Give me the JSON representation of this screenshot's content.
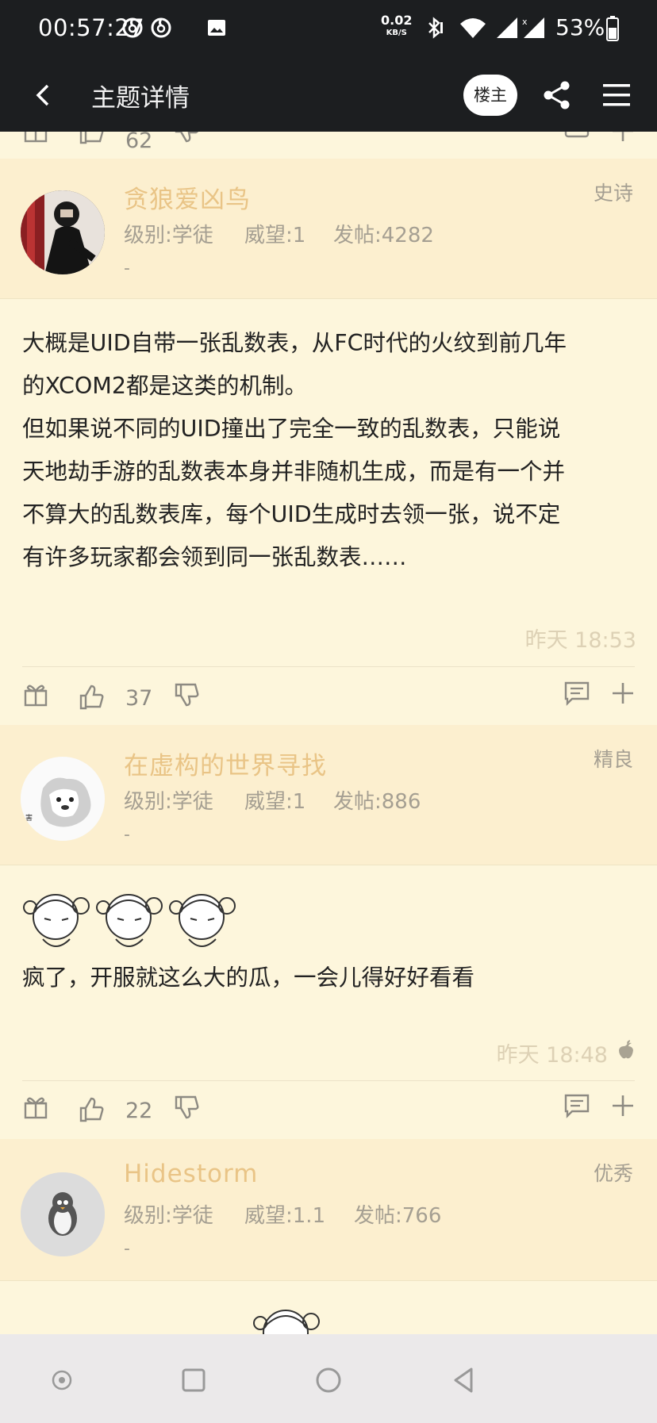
{
  "status_bar": {
    "time": "00:57:27",
    "net_speed_value": "0.02",
    "net_speed_unit": "KB/S",
    "battery_percent": "53%",
    "icons": [
      "netease-music-icon",
      "netease-music-icon",
      "image-icon",
      "bluetooth-icon",
      "wifi-icon",
      "signal-icon",
      "signal-x-icon",
      "battery-icon"
    ]
  },
  "app_bar": {
    "title": "主题详情",
    "louzhu_label": "楼主"
  },
  "prev_post_actions": {
    "like_count": "62"
  },
  "posts": [
    {
      "username": "贪狼爱凶鸟",
      "rank": "史诗",
      "level": "级别:学徒",
      "prestige": "威望:1",
      "posts": "发帖:4282",
      "signature": "-",
      "content_lines": [
        "大概是UID自带一张乱数表，从FC时代的火纹到前几年",
        "的XCOM2都是这类的机制。",
        "但如果说不同的UID撞出了完全一致的乱数表，只能说",
        "天地劫手游的乱数表本身并非随机生成，而是有一个并",
        "不算大的乱数表库，每个UID生成时去领一张，说不定",
        "有许多玩家都会领到同一张乱数表……"
      ],
      "time": "昨天 18:53",
      "like_count": "37"
    },
    {
      "username": "在虚构的世界寻找",
      "rank": "精良",
      "level": "级别:学徒",
      "prestige": "威望:1",
      "posts": "发帖:886",
      "signature": "-",
      "content_lines": [
        "疯了，开服就这么大的瓜，一会儿得好好看看"
      ],
      "time": "昨天 18:48",
      "like_count": "22"
    },
    {
      "username": "Hidestorm",
      "rank": "优秀",
      "level": "级别:学徒",
      "prestige": "威望:1.1",
      "posts": "发帖:766",
      "signature": "-"
    }
  ],
  "colors": {
    "bar_bg": "#1c1e20",
    "page_bg": "#fdf6dc",
    "header_bg": "#fcefcf",
    "username": "#e9c486",
    "meta": "#a59f92"
  }
}
